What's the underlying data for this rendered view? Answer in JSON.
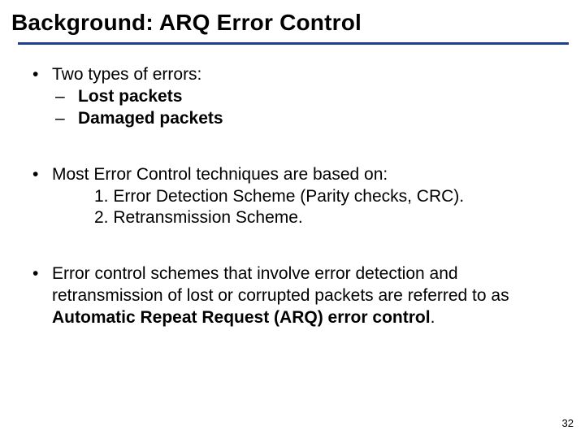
{
  "title": "Background:  ARQ Error Control",
  "groups": [
    {
      "lead": "Two types of errors:",
      "sub": [
        {
          "text": "Lost packets",
          "bold": true
        },
        {
          "text": "Damaged packets",
          "bold": true
        }
      ]
    },
    {
      "lead": "Most Error Control techniques are based on:",
      "num": [
        "1. Error Detection Scheme  (Parity checks, CRC).",
        "2. Retransmission Scheme."
      ]
    },
    {
      "lead_parts": {
        "a": "Error control schemes that involve error detection and retransmission of lost or corrupted packets are referred to as ",
        "b": "Automatic Repeat Request (ARQ) error control",
        "c": "."
      }
    }
  ],
  "bullets": {
    "l1": "•",
    "l2": "–"
  },
  "page": "32"
}
